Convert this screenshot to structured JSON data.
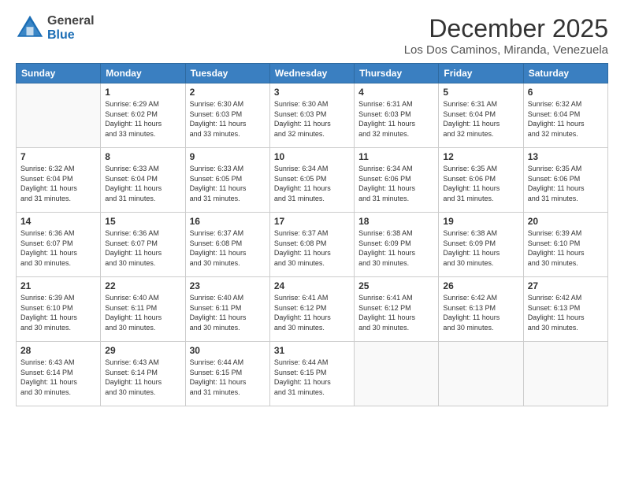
{
  "header": {
    "logo_general": "General",
    "logo_blue": "Blue",
    "month_title": "December 2025",
    "location": "Los Dos Caminos, Miranda, Venezuela"
  },
  "weekdays": [
    "Sunday",
    "Monday",
    "Tuesday",
    "Wednesday",
    "Thursday",
    "Friday",
    "Saturday"
  ],
  "weeks": [
    [
      {
        "day": "",
        "info": ""
      },
      {
        "day": "1",
        "info": "Sunrise: 6:29 AM\nSunset: 6:02 PM\nDaylight: 11 hours\nand 33 minutes."
      },
      {
        "day": "2",
        "info": "Sunrise: 6:30 AM\nSunset: 6:03 PM\nDaylight: 11 hours\nand 33 minutes."
      },
      {
        "day": "3",
        "info": "Sunrise: 6:30 AM\nSunset: 6:03 PM\nDaylight: 11 hours\nand 32 minutes."
      },
      {
        "day": "4",
        "info": "Sunrise: 6:31 AM\nSunset: 6:03 PM\nDaylight: 11 hours\nand 32 minutes."
      },
      {
        "day": "5",
        "info": "Sunrise: 6:31 AM\nSunset: 6:04 PM\nDaylight: 11 hours\nand 32 minutes."
      },
      {
        "day": "6",
        "info": "Sunrise: 6:32 AM\nSunset: 6:04 PM\nDaylight: 11 hours\nand 32 minutes."
      }
    ],
    [
      {
        "day": "7",
        "info": "Sunrise: 6:32 AM\nSunset: 6:04 PM\nDaylight: 11 hours\nand 31 minutes."
      },
      {
        "day": "8",
        "info": "Sunrise: 6:33 AM\nSunset: 6:04 PM\nDaylight: 11 hours\nand 31 minutes."
      },
      {
        "day": "9",
        "info": "Sunrise: 6:33 AM\nSunset: 6:05 PM\nDaylight: 11 hours\nand 31 minutes."
      },
      {
        "day": "10",
        "info": "Sunrise: 6:34 AM\nSunset: 6:05 PM\nDaylight: 11 hours\nand 31 minutes."
      },
      {
        "day": "11",
        "info": "Sunrise: 6:34 AM\nSunset: 6:06 PM\nDaylight: 11 hours\nand 31 minutes."
      },
      {
        "day": "12",
        "info": "Sunrise: 6:35 AM\nSunset: 6:06 PM\nDaylight: 11 hours\nand 31 minutes."
      },
      {
        "day": "13",
        "info": "Sunrise: 6:35 AM\nSunset: 6:06 PM\nDaylight: 11 hours\nand 31 minutes."
      }
    ],
    [
      {
        "day": "14",
        "info": "Sunrise: 6:36 AM\nSunset: 6:07 PM\nDaylight: 11 hours\nand 30 minutes."
      },
      {
        "day": "15",
        "info": "Sunrise: 6:36 AM\nSunset: 6:07 PM\nDaylight: 11 hours\nand 30 minutes."
      },
      {
        "day": "16",
        "info": "Sunrise: 6:37 AM\nSunset: 6:08 PM\nDaylight: 11 hours\nand 30 minutes."
      },
      {
        "day": "17",
        "info": "Sunrise: 6:37 AM\nSunset: 6:08 PM\nDaylight: 11 hours\nand 30 minutes."
      },
      {
        "day": "18",
        "info": "Sunrise: 6:38 AM\nSunset: 6:09 PM\nDaylight: 11 hours\nand 30 minutes."
      },
      {
        "day": "19",
        "info": "Sunrise: 6:38 AM\nSunset: 6:09 PM\nDaylight: 11 hours\nand 30 minutes."
      },
      {
        "day": "20",
        "info": "Sunrise: 6:39 AM\nSunset: 6:10 PM\nDaylight: 11 hours\nand 30 minutes."
      }
    ],
    [
      {
        "day": "21",
        "info": "Sunrise: 6:39 AM\nSunset: 6:10 PM\nDaylight: 11 hours\nand 30 minutes."
      },
      {
        "day": "22",
        "info": "Sunrise: 6:40 AM\nSunset: 6:11 PM\nDaylight: 11 hours\nand 30 minutes."
      },
      {
        "day": "23",
        "info": "Sunrise: 6:40 AM\nSunset: 6:11 PM\nDaylight: 11 hours\nand 30 minutes."
      },
      {
        "day": "24",
        "info": "Sunrise: 6:41 AM\nSunset: 6:12 PM\nDaylight: 11 hours\nand 30 minutes."
      },
      {
        "day": "25",
        "info": "Sunrise: 6:41 AM\nSunset: 6:12 PM\nDaylight: 11 hours\nand 30 minutes."
      },
      {
        "day": "26",
        "info": "Sunrise: 6:42 AM\nSunset: 6:13 PM\nDaylight: 11 hours\nand 30 minutes."
      },
      {
        "day": "27",
        "info": "Sunrise: 6:42 AM\nSunset: 6:13 PM\nDaylight: 11 hours\nand 30 minutes."
      }
    ],
    [
      {
        "day": "28",
        "info": "Sunrise: 6:43 AM\nSunset: 6:14 PM\nDaylight: 11 hours\nand 30 minutes."
      },
      {
        "day": "29",
        "info": "Sunrise: 6:43 AM\nSunset: 6:14 PM\nDaylight: 11 hours\nand 30 minutes."
      },
      {
        "day": "30",
        "info": "Sunrise: 6:44 AM\nSunset: 6:15 PM\nDaylight: 11 hours\nand 31 minutes."
      },
      {
        "day": "31",
        "info": "Sunrise: 6:44 AM\nSunset: 6:15 PM\nDaylight: 11 hours\nand 31 minutes."
      },
      {
        "day": "",
        "info": ""
      },
      {
        "day": "",
        "info": ""
      },
      {
        "day": "",
        "info": ""
      }
    ]
  ]
}
